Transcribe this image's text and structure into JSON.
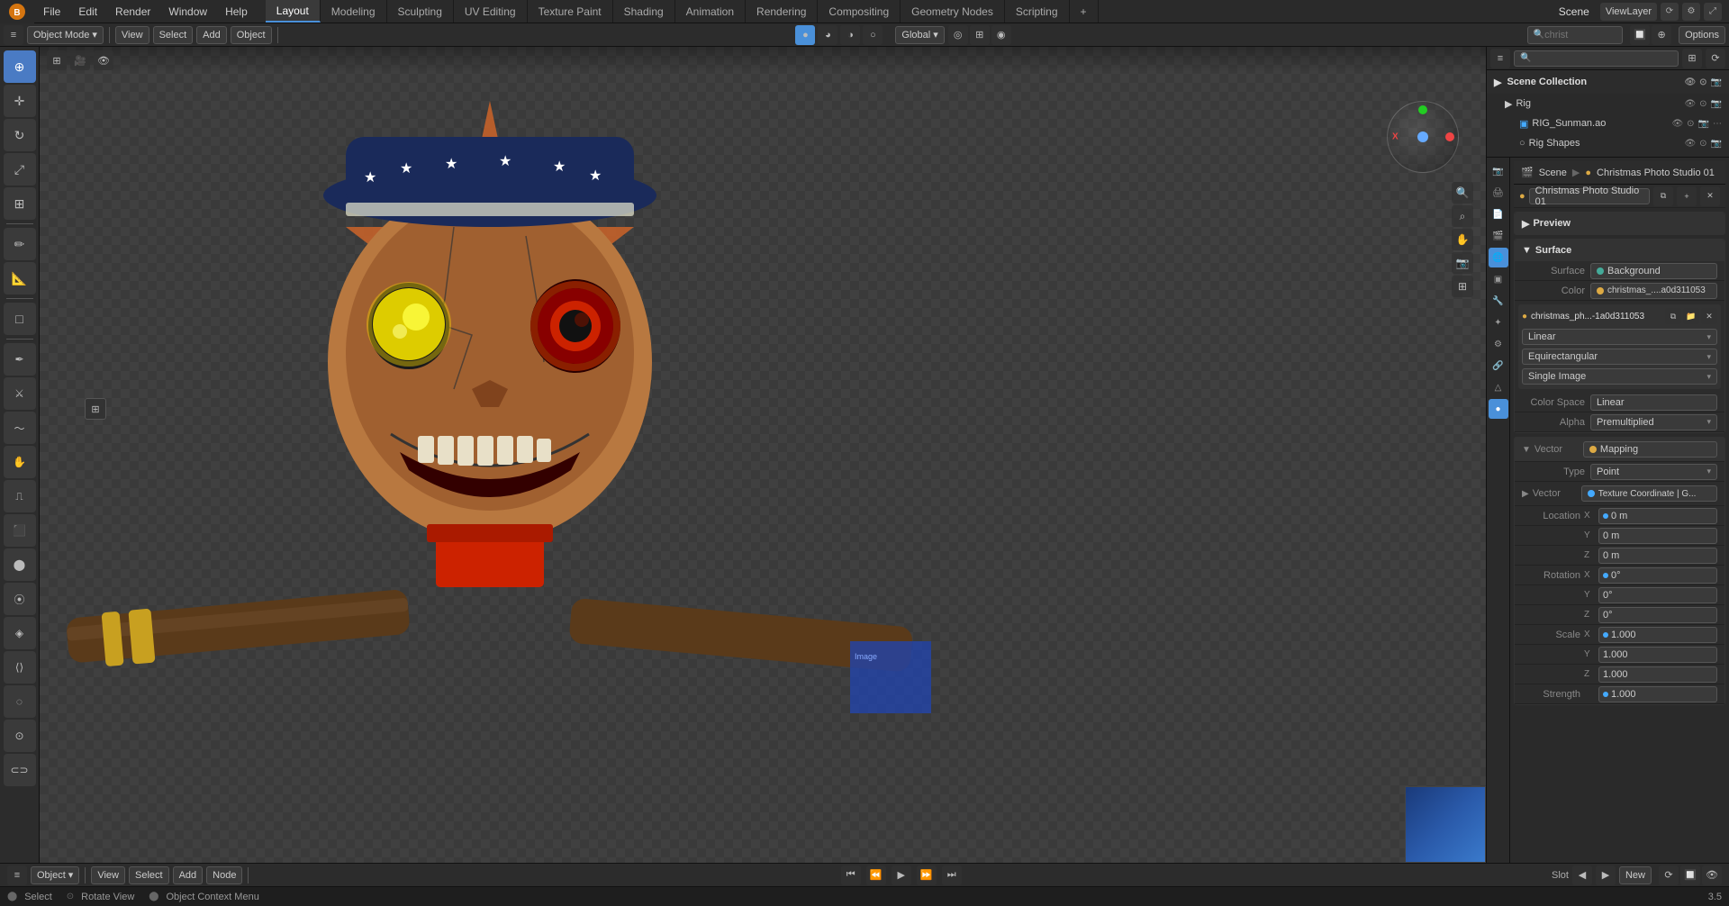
{
  "app": {
    "title": "Blender",
    "version": "3.5"
  },
  "top_menu": {
    "items": [
      "File",
      "Edit",
      "Render",
      "Window",
      "Help"
    ]
  },
  "workspace_tabs": [
    {
      "label": "Layout",
      "active": true
    },
    {
      "label": "Modeling"
    },
    {
      "label": "Sculpting"
    },
    {
      "label": "UV Editing"
    },
    {
      "label": "Texture Paint"
    },
    {
      "label": "Shading"
    },
    {
      "label": "Animation"
    },
    {
      "label": "Rendering"
    },
    {
      "label": "Compositing"
    },
    {
      "label": "Geometry Nodes"
    },
    {
      "label": "Scripting"
    },
    {
      "label": "+"
    }
  ],
  "top_right": {
    "scene_name": "Scene",
    "view_layer": "ViewLayer"
  },
  "second_toolbar": {
    "mode": "Object Mode",
    "view_label": "View",
    "select_label": "Select",
    "add_label": "Add",
    "object_label": "Object",
    "transform_label": "Global",
    "search_placeholder": "christ"
  },
  "left_tools": [
    {
      "name": "cursor-tool",
      "icon": "⊕"
    },
    {
      "name": "move-tool",
      "icon": "✛"
    },
    {
      "name": "rotate-tool",
      "icon": "↻"
    },
    {
      "name": "scale-tool",
      "icon": "⤢"
    },
    {
      "name": "transform-tool",
      "icon": "⊞"
    },
    {
      "name": "annotate-tool",
      "icon": "✏"
    },
    {
      "name": "measure-tool",
      "icon": "📐"
    },
    {
      "name": "add-cube-tool",
      "icon": "□"
    },
    {
      "name": "extrude-tool",
      "icon": "⬆"
    }
  ],
  "viewport": {
    "mode": "Object Mode",
    "options_label": "Options"
  },
  "scene_collection": {
    "title": "Scene Collection",
    "items": [
      {
        "name": "Rig",
        "level": 1,
        "expanded": true
      },
      {
        "name": "RIG_Sunman.ao",
        "level": 2
      },
      {
        "name": "Rig Shapes",
        "level": 2
      }
    ]
  },
  "properties_panel": {
    "breadcrumb": {
      "scene": "Scene",
      "material": "Christmas Photo Studio 01"
    },
    "material_name": "Christmas Photo Studio 01",
    "sections": {
      "preview": {
        "label": "Preview"
      },
      "surface": {
        "label": "Surface",
        "surface_type": "Background",
        "color_label": "Color",
        "color_value": "christmas_....a0d311053",
        "node_name": "christmas_ph...-1a0d311053",
        "interpolation": "Linear",
        "projection": "Equirectangular",
        "source": "Single Image",
        "color_space_label": "Color Space",
        "color_space_value": "Linear",
        "alpha_label": "Alpha",
        "alpha_value": "Premultiplied"
      },
      "vector": {
        "label": "Vector",
        "vector_type": "Mapping",
        "type_label": "Type",
        "type_value": "Point",
        "vector2_label": "Vector",
        "vector2_value": "Texture Coordinate | G...",
        "location": {
          "label": "Location",
          "x": "0 m",
          "y": "0 m",
          "z": "0 m"
        },
        "rotation": {
          "label": "Rotation",
          "x": "0°",
          "y": "0°",
          "z": "0°"
        },
        "scale": {
          "label": "Scale",
          "x": "1.000",
          "y": "1.000",
          "z": "1.000"
        },
        "strength": {
          "label": "Strength",
          "value": "1.000"
        }
      }
    }
  },
  "bottom_toolbar": {
    "mode": "Object",
    "view_label": "View",
    "select_label": "Select",
    "add_label": "Add",
    "node_label": "Node",
    "slot_label": "Slot",
    "new_label": "New"
  },
  "status_bar": {
    "select_label": "Select",
    "rotate_view": "Rotate View",
    "context_menu": "Object Context Menu",
    "frame": "3.5"
  },
  "prop_icons": [
    {
      "name": "render-icon",
      "icon": "📷",
      "tooltip": "Render"
    },
    {
      "name": "output-icon",
      "icon": "🖨",
      "tooltip": "Output"
    },
    {
      "name": "view-layer-icon",
      "icon": "📄",
      "tooltip": "View Layer"
    },
    {
      "name": "scene-icon",
      "icon": "🎬",
      "tooltip": "Scene"
    },
    {
      "name": "world-icon",
      "icon": "🌐",
      "tooltip": "World"
    },
    {
      "name": "object-icon",
      "icon": "▣",
      "tooltip": "Object"
    },
    {
      "name": "modifier-icon",
      "icon": "🔧",
      "tooltip": "Modifier"
    },
    {
      "name": "particle-icon",
      "icon": "✦",
      "tooltip": "Particle"
    },
    {
      "name": "physics-icon",
      "icon": "⚙",
      "tooltip": "Physics"
    },
    {
      "name": "constraint-icon",
      "icon": "🔗",
      "tooltip": "Constraint"
    },
    {
      "name": "data-icon",
      "icon": "△",
      "tooltip": "Data"
    },
    {
      "name": "material-icon",
      "icon": "●",
      "tooltip": "Material",
      "active": true
    }
  ]
}
